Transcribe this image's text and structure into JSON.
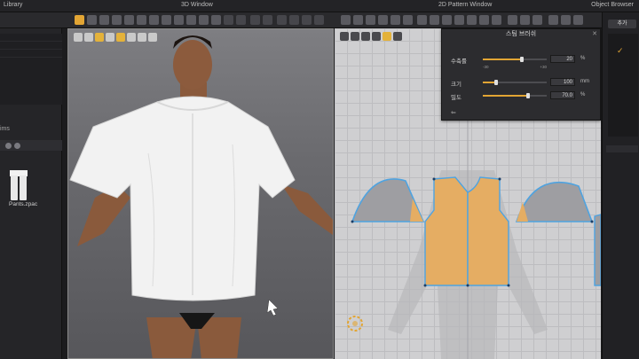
{
  "titlebar": {
    "left_label": "Library",
    "window_3d": "3D Window",
    "window_2d": "2D Pattern Window",
    "right_label": "Object Browser"
  },
  "library": {
    "label": "ims",
    "item_name": "Pants.zpac"
  },
  "stitch_popup": {
    "title": "스팀 브러쉬",
    "close": "✕",
    "rows": [
      {
        "label": "수축률",
        "value": "20",
        "unit": "%",
        "fraction": 0.6
      },
      {
        "label": "크기",
        "value": "100",
        "unit": "mm",
        "fraction": 0.2
      },
      {
        "label": "밀도",
        "value": "70.0",
        "unit": "%",
        "fraction": 0.7
      }
    ],
    "min": "-30",
    "max": "+30",
    "back": "⇐"
  },
  "right_panel": {
    "add_label": "추가",
    "check": "✓"
  },
  "colors": {
    "accent": "#e2a534",
    "pattern_fill": "#e5ad63",
    "pattern_outline": "#4fa3e0",
    "shirt": "#f2f2f2"
  },
  "icons": [
    "select-pattern-icon",
    "transform-icon",
    "avatar-icon",
    "garment-icon",
    "steam-icon",
    "cursor-icon"
  ]
}
